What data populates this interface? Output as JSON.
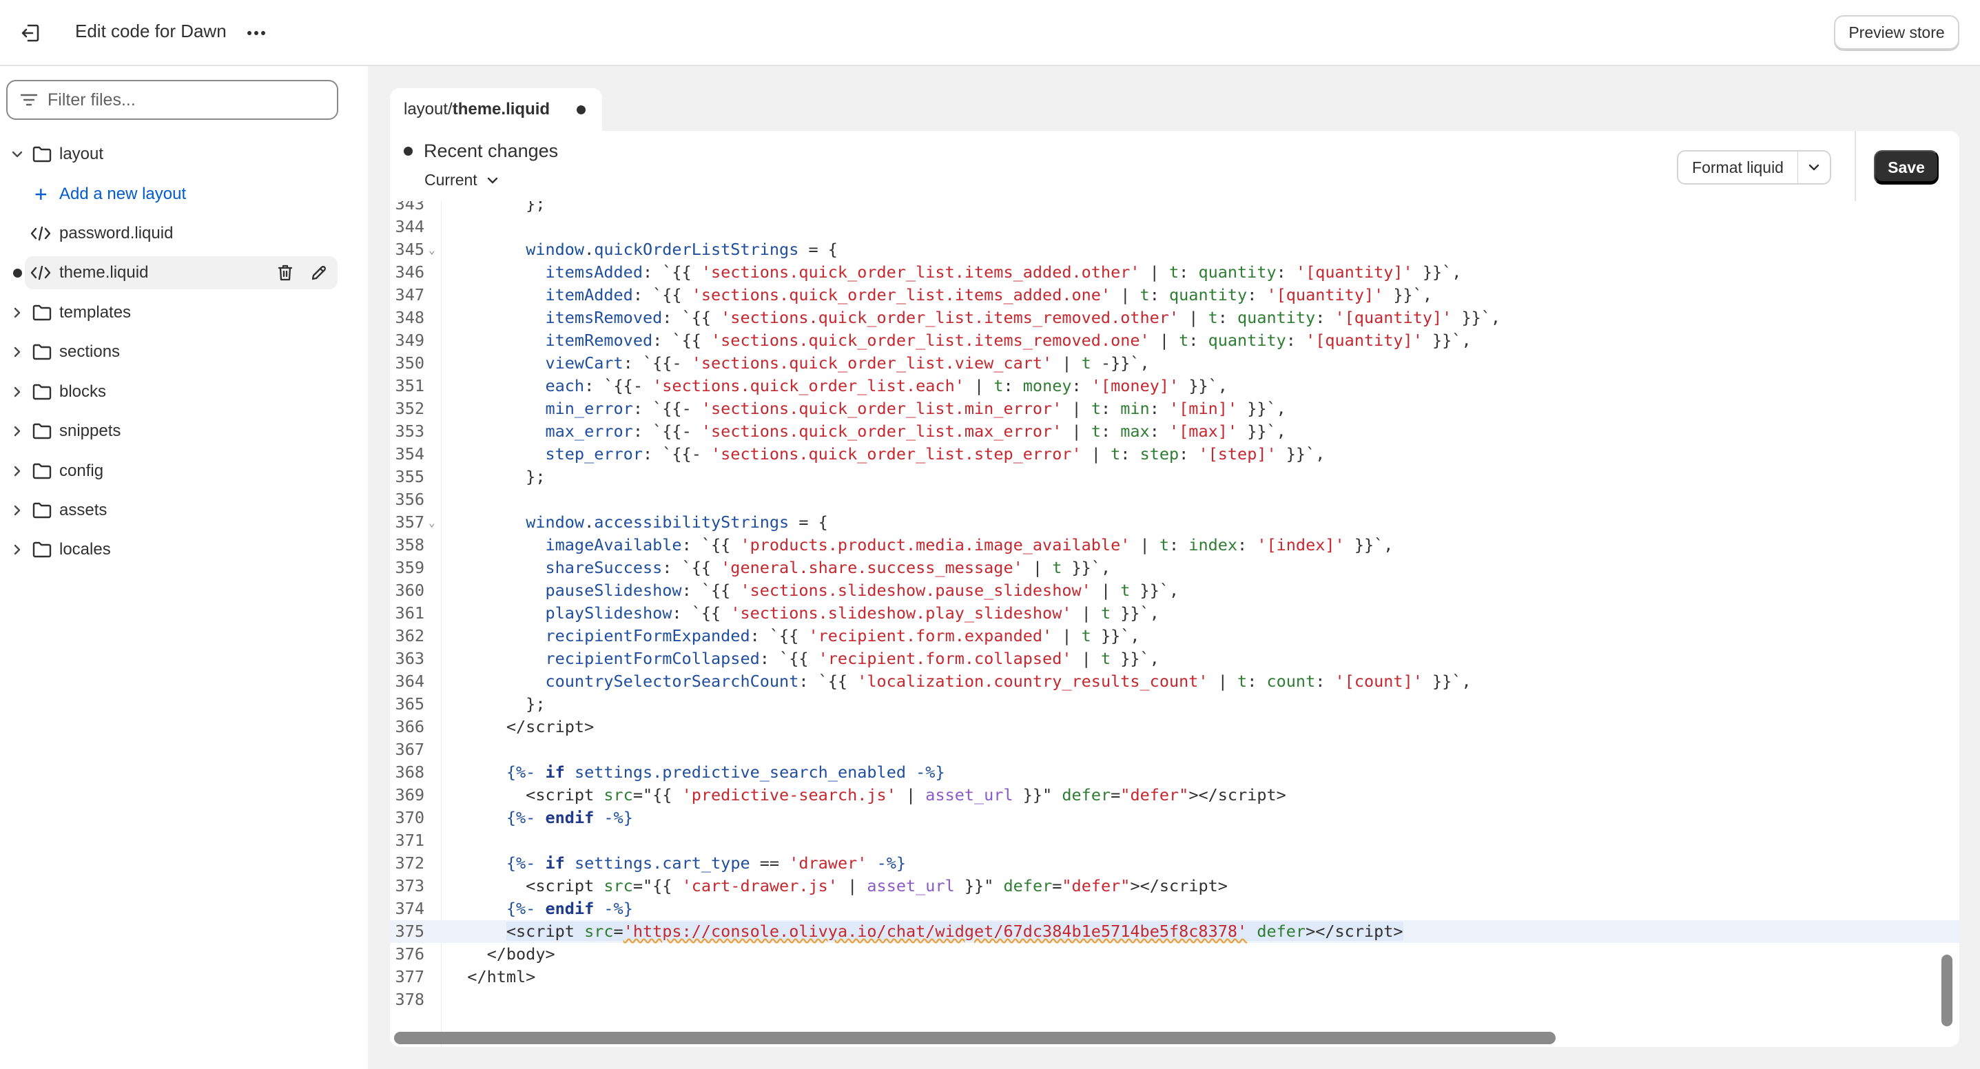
{
  "topbar": {
    "title": "Edit code for Dawn",
    "preview_label": "Preview store",
    "icons": [
      "exit-icon",
      "more-horizontal-icon"
    ]
  },
  "sidebar": {
    "filter_placeholder": "Filter files...",
    "layout_folder": "layout",
    "add_layout_label": "Add a new layout",
    "files": [
      "password.liquid",
      "theme.liquid"
    ],
    "folders": [
      "templates",
      "sections",
      "blocks",
      "snippets",
      "config",
      "assets",
      "locales"
    ]
  },
  "editor": {
    "tab_dir": "layout/",
    "tab_file": "theme.liquid",
    "recent_changes": "Recent changes",
    "current_label": "Current",
    "format_label": "Format liquid",
    "save_label": "Save"
  },
  "code": {
    "line_numbers": [
      "343",
      "344",
      "345",
      "346",
      "347",
      "348",
      "349",
      "350",
      "351",
      "352",
      "353",
      "354",
      "355",
      "356",
      "357",
      "358",
      "359",
      "360",
      "361",
      "362",
      "363",
      "364",
      "365",
      "366",
      "367",
      "368",
      "369",
      "370",
      "371",
      "372",
      "373",
      "374",
      "375",
      "376",
      "377",
      "378"
    ],
    "active_line": "375"
  },
  "colors": {
    "link_blue": "#005bd3",
    "save_bg": "#303030",
    "string_red": "#c5282f",
    "filter_green": "#2e7d32",
    "liquid_purple": "#8a5bc7"
  }
}
